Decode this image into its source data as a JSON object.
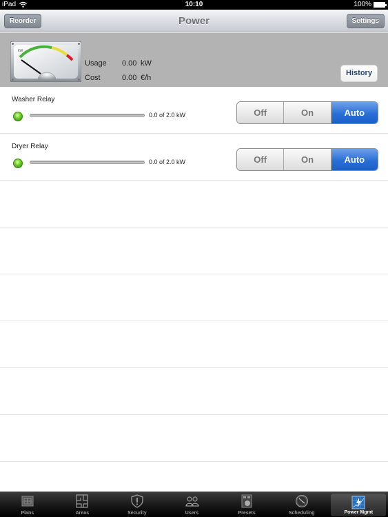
{
  "status_bar": {
    "device": "iPad",
    "time": "10:10",
    "battery": "100%"
  },
  "navbar": {
    "title": "Power",
    "left_button": "Reorder",
    "right_button": "Settings"
  },
  "summary": {
    "gauge_unit": "kW",
    "usage_label": "Usage",
    "usage_value": "0.00",
    "usage_unit": "kW",
    "cost_label": "Cost",
    "cost_value": "0.00",
    "cost_unit": "€/h",
    "history_button": "History"
  },
  "relays": [
    {
      "name": "Washer Relay",
      "load_text": "0.0 of 2.0 kW",
      "load_fraction": 0,
      "status": "on",
      "modes": [
        "Off",
        "On",
        "Auto"
      ],
      "selected_mode": "Auto"
    },
    {
      "name": "Dryer Relay",
      "load_text": "0.0 of 2.0 kW",
      "load_fraction": 0,
      "status": "on",
      "modes": [
        "Off",
        "On",
        "Auto"
      ],
      "selected_mode": "Auto"
    }
  ],
  "tabbar": {
    "items": [
      {
        "label": "Plans",
        "icon": "floor-plan-icon"
      },
      {
        "label": "Areas",
        "icon": "areas-icon"
      },
      {
        "label": "Security",
        "icon": "shield-icon"
      },
      {
        "label": "Users",
        "icon": "users-icon"
      },
      {
        "label": "Presets",
        "icon": "presets-icon"
      },
      {
        "label": "Scheduling",
        "icon": "clock-icon"
      },
      {
        "label": "Power Mgmt",
        "icon": "power-chart-icon"
      }
    ],
    "active": "Power Mgmt"
  },
  "colors": {
    "accent": "#2a6fd6",
    "led": "#5cc22a",
    "summary_bg": "#b3b3b3"
  }
}
